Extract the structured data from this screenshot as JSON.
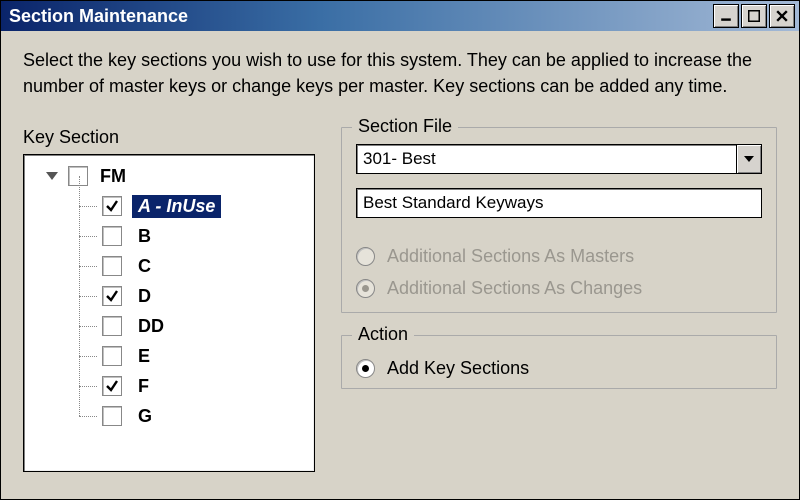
{
  "window": {
    "title": "Section Maintenance"
  },
  "instructions": "Select the key sections you wish to use for this system.  They can be applied to increase the number of master keys or change keys per master.  Key sections can be added any time.",
  "left_panel": {
    "label": "Key Section",
    "root": {
      "label": "FM",
      "checked": false
    },
    "items": [
      {
        "label": "A - InUse",
        "checked": true,
        "selected": true
      },
      {
        "label": "B",
        "checked": false,
        "selected": false
      },
      {
        "label": "C",
        "checked": false,
        "selected": false
      },
      {
        "label": "D",
        "checked": true,
        "selected": false
      },
      {
        "label": "DD",
        "checked": false,
        "selected": false
      },
      {
        "label": "E",
        "checked": false,
        "selected": false
      },
      {
        "label": "F",
        "checked": true,
        "selected": false
      },
      {
        "label": "G",
        "checked": false,
        "selected": false
      }
    ]
  },
  "section_file": {
    "legend": "Section File",
    "dropdown_value": "301- Best",
    "text_value": "Best Standard Keyways",
    "radio_masters": "Additional Sections As Masters",
    "radio_changes": "Additional Sections As Changes"
  },
  "action": {
    "legend": "Action",
    "radio_add": "Add Key Sections"
  }
}
